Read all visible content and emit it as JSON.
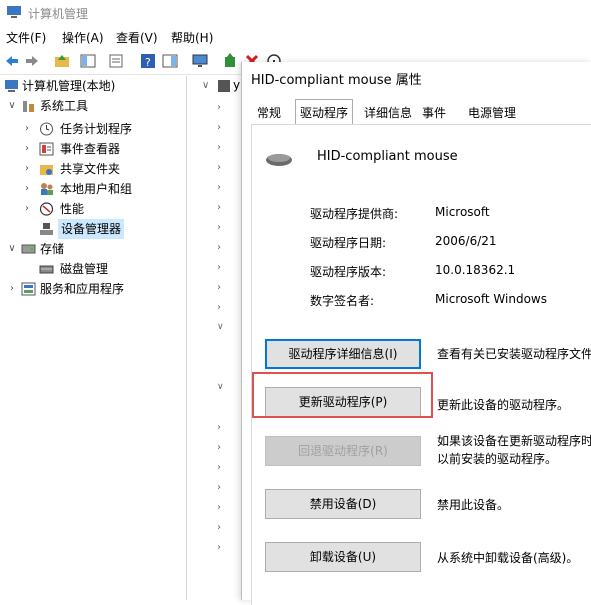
{
  "window": {
    "title": "计算机管理",
    "app_icon": "computer-management-icon"
  },
  "menubar": {
    "file": "文件(F)",
    "action": "操作(A)",
    "view": "查看(V)",
    "help": "帮助(H)"
  },
  "toolbar": {
    "icons": [
      "back-arrow-icon",
      "forward-arrow-icon",
      "up-folder-icon",
      "show-tree-icon",
      "properties-icon",
      "help-icon",
      "console-icon",
      "monitor-icon",
      "driver-update-icon",
      "remove-icon",
      "info-icon"
    ]
  },
  "tree": {
    "root": "计算机管理(本地)",
    "system_tools": "系统工具",
    "task_scheduler": "任务计划程序",
    "event_viewer": "事件查看器",
    "shared_folders": "共享文件夹",
    "local_users": "本地用户和组",
    "performance": "性能",
    "device_manager": "设备管理器",
    "storage": "存储",
    "disk_management": "磁盘管理",
    "services_apps": "服务和应用程序"
  },
  "middle": {
    "fragment": "y"
  },
  "dialog": {
    "title": "HID-compliant mouse 属性",
    "tabs": [
      "常规",
      "驱动程序",
      "详细信息",
      "事件",
      "电源管理"
    ],
    "active_tab": "驱动程序",
    "device_name": "HID-compliant mouse",
    "info": {
      "provider_label": "驱动程序提供商:",
      "provider_value": "Microsoft",
      "date_label": "驱动程序日期:",
      "date_value": "2006/6/21",
      "version_label": "驱动程序版本:",
      "version_value": "10.0.18362.1",
      "signer_label": "数字签名者:",
      "signer_value": "Microsoft Windows"
    },
    "buttons": {
      "details": "驱动程序详细信息(I)",
      "details_desc": "查看有关已安装驱动程序文件",
      "update": "更新驱动程序(P)",
      "update_desc": "更新此设备的驱动程序。",
      "rollback": "回退驱动程序(R)",
      "rollback_desc_1": "如果该设备在更新驱动程序时",
      "rollback_desc_2": "以前安装的驱动程序。",
      "disable": "禁用设备(D)",
      "disable_desc": "禁用此设备。",
      "uninstall": "卸载设备(U)",
      "uninstall_desc": "从系统中卸载设备(高级)。"
    }
  },
  "colors": {
    "selection": "#cce8ff",
    "highlight_box": "#e05050",
    "focus": "#0078d7"
  }
}
